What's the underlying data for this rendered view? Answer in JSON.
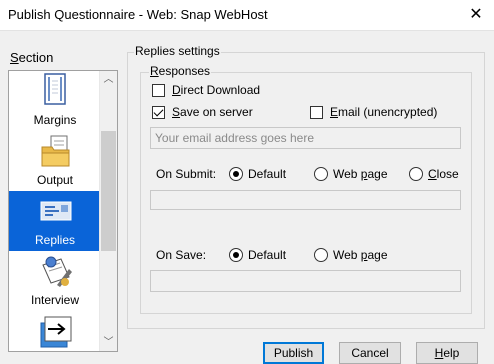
{
  "window": {
    "title": "Publish Questionnaire - Web: Snap WebHost",
    "close_glyph": "✕"
  },
  "section": {
    "label_ul": "S",
    "label_rest": "ection",
    "items": [
      {
        "label": "Margins",
        "icon": "margins-icon"
      },
      {
        "label": "Output",
        "icon": "output-folder-icon"
      },
      {
        "label": "Replies",
        "icon": "replies-icon",
        "selected": true
      },
      {
        "label": "Interview",
        "icon": "interview-icon"
      },
      {
        "label": "",
        "icon": "export-arrow-icon"
      }
    ]
  },
  "replies_settings": {
    "group_title": "Replies settings",
    "responses": {
      "title_ul": "R",
      "title_rest": "esponses",
      "direct_download": {
        "ul": "D",
        "rest": "irect Download",
        "checked": false
      },
      "save_on_server": {
        "ul": "S",
        "rest": "ave on server",
        "checked": true
      },
      "email": {
        "ul": "E",
        "rest": "mail (unencrypted)",
        "checked": false
      },
      "email_placeholder": "Your email address goes here",
      "on_submit": {
        "label": "On Submit:",
        "options": [
          {
            "ul": "",
            "text": "Default",
            "checked": true
          },
          {
            "text_pre": "Web ",
            "ul": "p",
            "text_post": "age",
            "checked": false
          },
          {
            "ul": "C",
            "text_post": "lose",
            "checked": false
          }
        ]
      },
      "on_save": {
        "label": "On Save:",
        "options": [
          {
            "text": "Default",
            "checked": true
          },
          {
            "text_pre": "Web ",
            "ul": "p",
            "text_post": "age",
            "checked": false
          }
        ]
      }
    }
  },
  "buttons": {
    "publish": "Publish",
    "cancel": "Cancel",
    "help_ul": "H",
    "help_rest": "elp"
  },
  "colors": {
    "selection": "#0a64d8",
    "default_button_border": "#0078d7"
  }
}
